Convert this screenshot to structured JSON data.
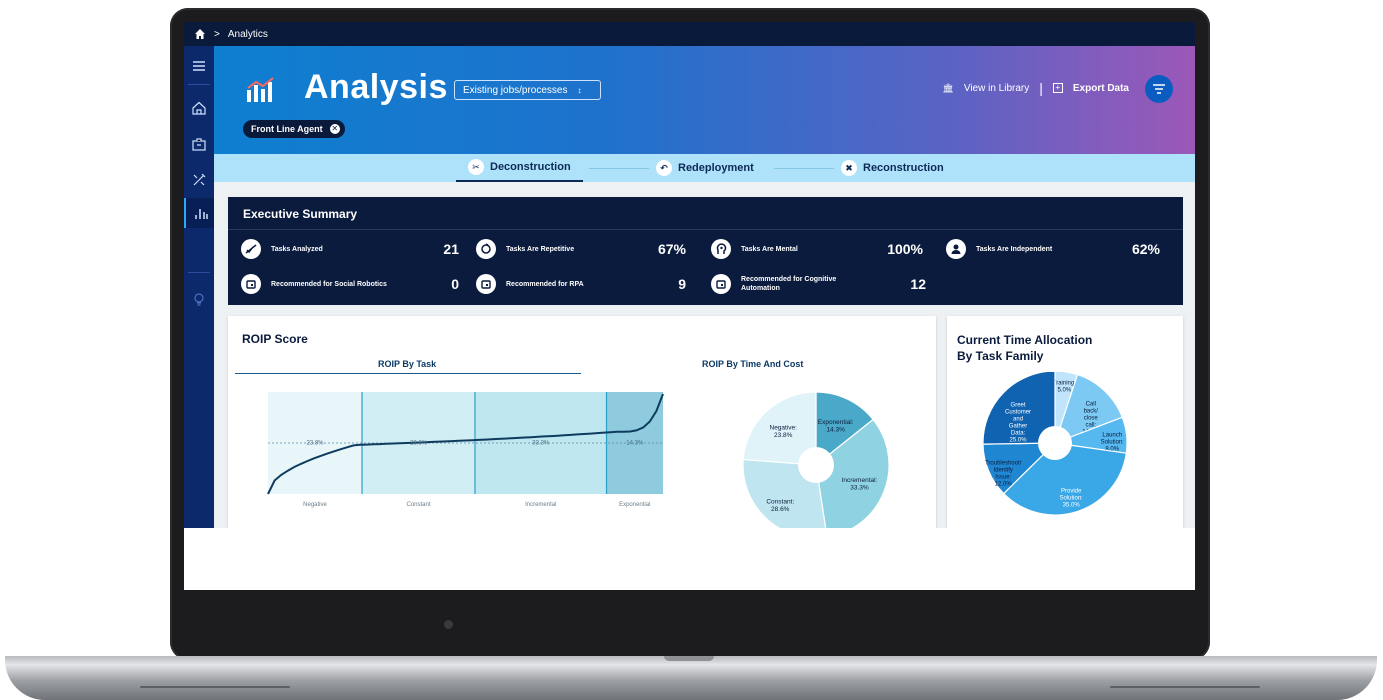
{
  "breadcrumb": {
    "separator": ">",
    "current": "Analytics"
  },
  "hero": {
    "title": "Analysis",
    "select_value": "Existing jobs/processes",
    "chip_label": "Front Line Agent",
    "view_library": "View in Library",
    "divider": "|",
    "export": "Export Data"
  },
  "tabs": [
    {
      "label": "Deconstruction",
      "active": true
    },
    {
      "label": "Redeployment",
      "active": false
    },
    {
      "label": "Reconstruction",
      "active": false
    }
  ],
  "executive_summary": {
    "title": "Executive Summary",
    "metrics": [
      {
        "label": "Tasks Analyzed",
        "value": "21",
        "icon": "chart-check-icon"
      },
      {
        "label": "Tasks Are Repetitive",
        "value": "67%",
        "icon": "repeat-icon"
      },
      {
        "label": "Tasks Are Mental",
        "value": "100%",
        "icon": "head-gear-icon"
      },
      {
        "label": "Tasks Are Independent",
        "value": "62%",
        "icon": "person-icon"
      },
      {
        "label": "Recommended for Social Robotics",
        "value": "0",
        "icon": "robot-icon"
      },
      {
        "label": "Recommended for RPA",
        "value": "9",
        "icon": "robot-icon"
      },
      {
        "label": "Recommended for Cognitive",
        "label2": "Automation",
        "value": "12",
        "icon": "robot-icon"
      }
    ]
  },
  "roip": {
    "title": "ROIP Score",
    "tab_task": "ROIP By Task",
    "tab_time_cost": "ROIP By Time And Cost"
  },
  "allocation": {
    "title_line1": "Current Time Allocation",
    "title_line2": "By Task Family"
  },
  "chart_data": [
    {
      "type": "area",
      "title": "ROIP By Task",
      "categories": [
        "Negative",
        "Constant",
        "Incremental",
        "Exponential"
      ],
      "values": [
        23.8,
        28.6,
        33.3,
        14.3
      ],
      "value_labels": [
        "23.8%",
        "28.6%",
        "33.3%",
        "14.3%"
      ]
    },
    {
      "type": "pie",
      "title": "ROIP By Time And Cost",
      "labels": [
        "Exponential",
        "Incremental",
        "Constant",
        "Negative"
      ],
      "values": [
        14.3,
        33.3,
        28.6,
        23.8
      ],
      "value_labels": [
        "14.3%",
        "33.3%",
        "28.6%",
        "23.8%"
      ],
      "colors": [
        "#4aa8c8",
        "#8fd3e2",
        "#bfe6f0",
        "#dff3f8"
      ]
    },
    {
      "type": "pie",
      "title": "Current Time Allocation By Task Family",
      "labels": [
        "Training",
        "Call back/ close call",
        "Launch Solution",
        "Provide Solution",
        "Troubleshoot/ Identify Issue",
        "Greet Customer and Gather Data"
      ],
      "values": [
        5.0,
        14.0,
        8.0,
        35.0,
        12.0,
        25.0
      ],
      "value_labels": [
        "5.0%",
        "14.0%",
        "8.0%",
        "35.0%",
        "12.0%",
        "25.0%"
      ],
      "colors": [
        "#bfe4fb",
        "#7ccaf3",
        "#55b8ee",
        "#3aa7e6",
        "#1f86d2",
        "#0f63b0"
      ]
    }
  ]
}
